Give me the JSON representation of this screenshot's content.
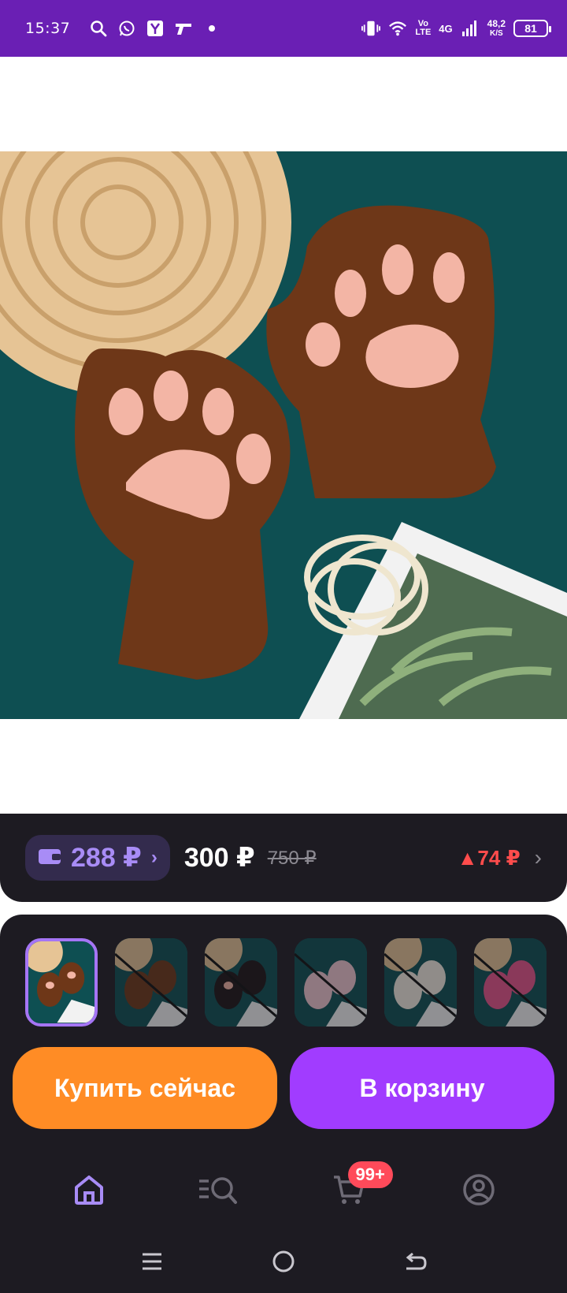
{
  "status_bar": {
    "time": "15:37",
    "network_label_top": "Vo",
    "network_label_bottom": "LTE",
    "network_type": "4G",
    "speed_value": "48,2",
    "speed_unit": "K/S",
    "battery": "81",
    "icons": [
      "search-icon",
      "whatsapp-icon",
      "yandex-icon",
      "pistol-icon",
      "dot-icon",
      "vibrate-icon",
      "wifi-icon",
      "signal-icon"
    ]
  },
  "product": {
    "image_description_icon": "cat-paw-gloves-photo"
  },
  "price_panel": {
    "wallet_price": "288 ₽",
    "wallet_chevron": "›",
    "price": "300 ₽",
    "old_price": "750 ₽",
    "delta": "▲74 ₽",
    "more_chevron": "›"
  },
  "thumbnails": [
    {
      "variant": "brown",
      "selected": true
    },
    {
      "variant": "brown-dim",
      "selected": false
    },
    {
      "variant": "black",
      "selected": false
    },
    {
      "variant": "pink-light",
      "selected": false
    },
    {
      "variant": "white",
      "selected": false
    },
    {
      "variant": "pink",
      "selected": false
    }
  ],
  "actions": {
    "buy_now": "Купить сейчас",
    "add_to_cart": "В корзину"
  },
  "tabbar": {
    "cart_badge": "99+",
    "tabs": [
      "home-icon",
      "catalog-search-icon",
      "cart-icon",
      "profile-icon"
    ]
  },
  "colors": {
    "status_bar": "#6a1fb4",
    "panel": "#1d1b22",
    "accent_purple": "#a88cf6",
    "buy_button": "#ff8c25",
    "cart_button": "#a13cff",
    "delta_red": "#ff4c4c",
    "badge": "#ff4a5a"
  }
}
